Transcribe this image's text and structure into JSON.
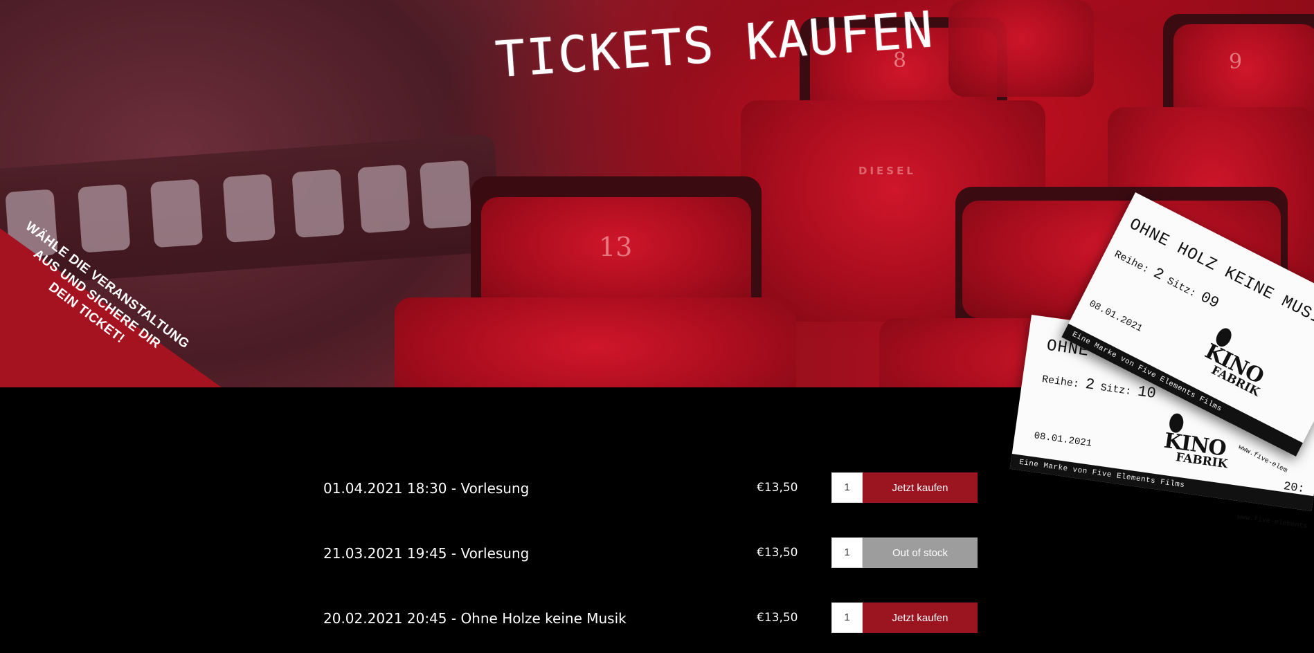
{
  "hero": {
    "title": "TICKETS KAUFEN",
    "banner_lines": [
      "WÄHLE DIE VERANSTALTUNG",
      "AUS UND SICHERE DIR",
      "DEIN TICKET!"
    ],
    "seat_numbers": [
      "13",
      "8",
      "9"
    ],
    "seat_label": "DIESEL"
  },
  "tickets": [
    {
      "title": "OHNE HOLZ KEINE MUSIK",
      "row_label": "Reihe:",
      "row": "2",
      "seat_label": "Sitz:",
      "seat": "09",
      "date": "08.01.2021",
      "strip": "Eine Marke von Five Elements Films",
      "url": "www.five-elem"
    },
    {
      "title": "OHNE",
      "row_label": "Reihe:",
      "row": "2",
      "seat_label": "Sitz:",
      "seat": "10",
      "date": "08.01.2021",
      "strip": "Eine Marke von Five Elements Films",
      "url": "www.five-elements",
      "corner": "20:"
    }
  ],
  "logo": {
    "top": "KINO",
    "bottom": "FABRIK"
  },
  "events": [
    {
      "title": "01.04.2021 18:30 - Vorlesung",
      "price": "€13,50",
      "qty": "1",
      "button": "Jetzt kaufen",
      "status": "active"
    },
    {
      "title": "21.03.2021 19:45 - Vorlesung",
      "price": "€13,50",
      "qty": "1",
      "button": "Out of stock",
      "status": "disabled"
    },
    {
      "title": "20.02.2021 20:45 - Ohne Holze keine Musik",
      "price": "€13,50",
      "qty": "1",
      "button": "Jetzt kaufen",
      "status": "active"
    }
  ],
  "colors": {
    "accent": "#9b1521",
    "disabled": "#9d9d9d",
    "background": "#000000"
  }
}
